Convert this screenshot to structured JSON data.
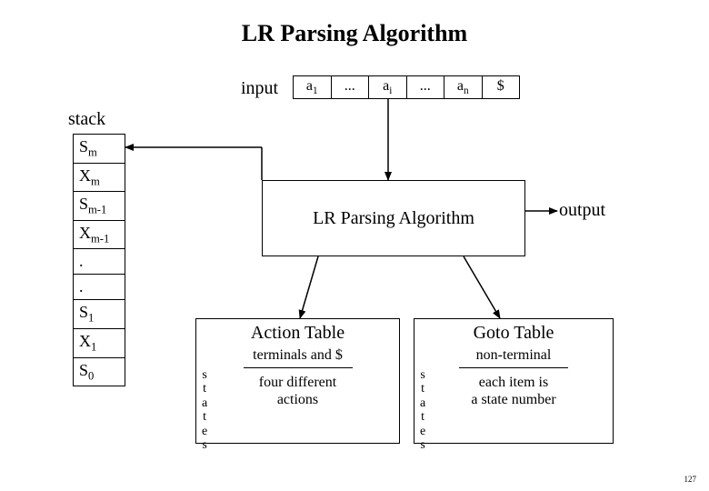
{
  "title": "LR Parsing Algorithm",
  "input_label": "input",
  "input_cells": [
    "a<sub>1</sub>",
    "...",
    "a<sub>i</sub>",
    "...",
    "a<sub>n</sub>",
    "$"
  ],
  "stack_label": "stack",
  "stack_cells": [
    "S<sub>m</sub>",
    "X<sub>m</sub>",
    "S<sub>m-1</sub>",
    "X<sub>m-1</sub>",
    ".",
    ".",
    "S<sub>1</sub>",
    "X<sub>1</sub>",
    "S<sub>0</sub>"
  ],
  "algo_box": "LR Parsing Algorithm",
  "output_label": "output",
  "action": {
    "title": "Action Table",
    "sub": "terminals and $",
    "body1": "four different",
    "body2": "actions"
  },
  "goto": {
    "title": "Goto Table",
    "sub": "non-terminal",
    "body1": "each item is",
    "body2": "a state number"
  },
  "side_label_chars": [
    "s",
    "t",
    "a",
    "t",
    "e",
    "s"
  ],
  "page_number": "127"
}
